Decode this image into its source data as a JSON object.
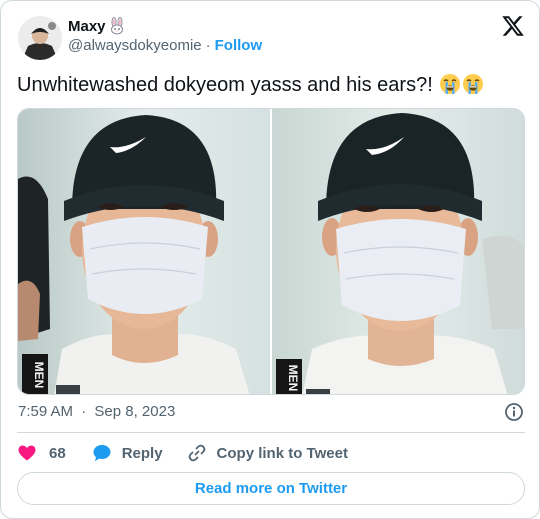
{
  "author": {
    "display_name": "Maxy",
    "handle": "@alwaysdokyeomie",
    "separator": "·",
    "follow_label": "Follow"
  },
  "tweet": {
    "text": "Unwhitewashed dokyeom yasss and his ears?!",
    "emojis": [
      "loudly-crying-face",
      "loudly-crying-face"
    ]
  },
  "media": {
    "count": 2,
    "left_photo_text": "MEN",
    "right_photo_text": "MEN"
  },
  "meta": {
    "time": "7:59 AM",
    "separator": "·",
    "date": "Sep 8, 2023"
  },
  "actions": {
    "like_count": "68",
    "reply_label": "Reply",
    "copy_label": "Copy link to Tweet"
  },
  "read_more_label": "Read more on Twitter",
  "colors": {
    "accent": "#1d9bf0",
    "like": "#f91880",
    "text_primary": "#0f1419",
    "text_secondary": "#536471",
    "border": "#cfd9de"
  }
}
